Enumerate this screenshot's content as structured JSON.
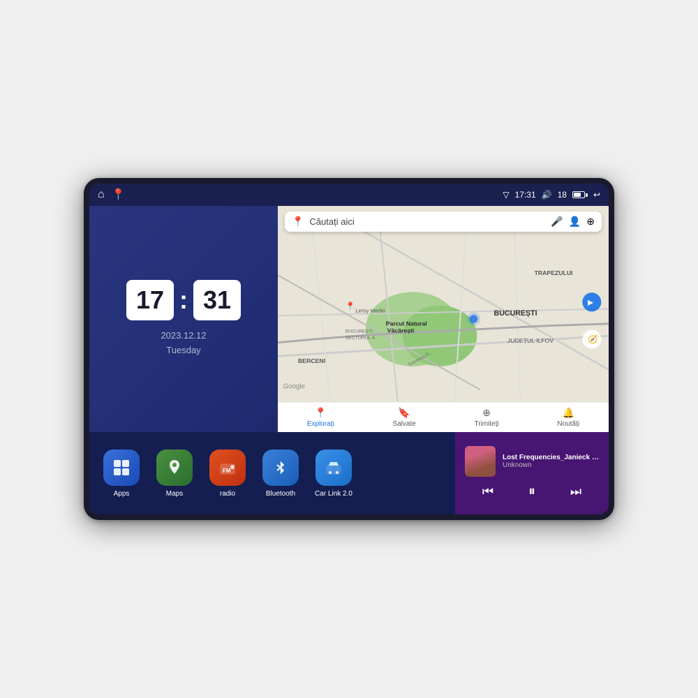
{
  "device": {
    "status_bar": {
      "time": "17:31",
      "signal_icon": "▽",
      "volume_icon": "🔊",
      "signal_bars": "18",
      "back_icon": "↩"
    },
    "clock": {
      "hour": "17",
      "minute": "31",
      "date": "2023.12.12",
      "day": "Tuesday"
    },
    "map": {
      "search_placeholder": "Căutați aici",
      "location_label_1": "Parcul Natural Văcărești",
      "location_label_2": "BUCUREȘTI",
      "location_label_3": "JUDEȚUL ILFOV",
      "location_label_4": "TRAPEZULUI",
      "location_label_5": "BERCENI",
      "bottom_items": [
        {
          "label": "Explorați",
          "active": true,
          "icon": "📍"
        },
        {
          "label": "Salvate",
          "active": false,
          "icon": "🔖"
        },
        {
          "label": "Trimiteți",
          "active": false,
          "icon": "⊕"
        },
        {
          "label": "Noutăți",
          "active": false,
          "icon": "🔔"
        }
      ]
    },
    "apps": [
      {
        "id": "apps",
        "label": "Apps",
        "icon": "⊞",
        "bg": "apps-bg"
      },
      {
        "id": "maps",
        "label": "Maps",
        "icon": "📍",
        "bg": "maps-bg"
      },
      {
        "id": "radio",
        "label": "radio",
        "icon": "📻",
        "bg": "radio-bg"
      },
      {
        "id": "bluetooth",
        "label": "Bluetooth",
        "icon": "🔷",
        "bg": "bt-bg"
      },
      {
        "id": "carlink",
        "label": "Car Link 2.0",
        "icon": "🚗",
        "bg": "carlink-bg"
      }
    ],
    "music": {
      "title": "Lost Frequencies_Janieck Devy-...",
      "artist": "Unknown",
      "prev_icon": "⏮",
      "play_icon": "⏸",
      "next_icon": "⏭"
    }
  }
}
